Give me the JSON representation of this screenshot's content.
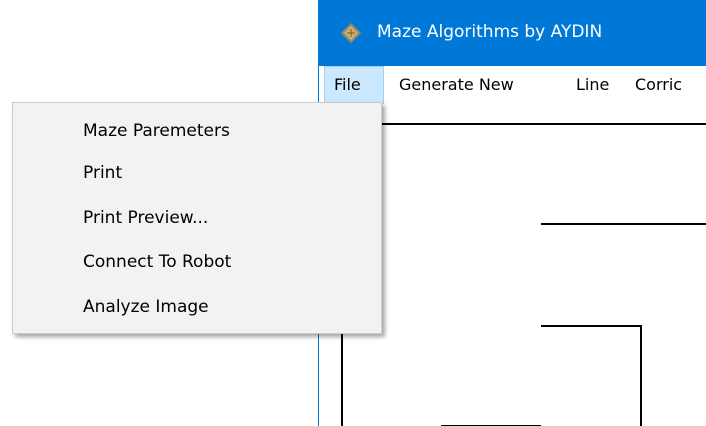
{
  "window": {
    "title": "Maze Algorithms by AYDIN",
    "icon": "maze-diamond-icon",
    "accent_color": "#0078d7"
  },
  "menubar": {
    "items": [
      {
        "label": "File",
        "active": true
      },
      {
        "label": "Generate New",
        "active": false
      },
      {
        "label": "Line",
        "active": false
      },
      {
        "label": "Corric",
        "active": false
      }
    ]
  },
  "file_menu": {
    "items": [
      {
        "label": "Maze Paremeters"
      },
      {
        "label": "Print"
      },
      {
        "label": "Print Preview..."
      },
      {
        "label": "Connect To Robot"
      },
      {
        "label": "Analyze Image"
      }
    ]
  }
}
